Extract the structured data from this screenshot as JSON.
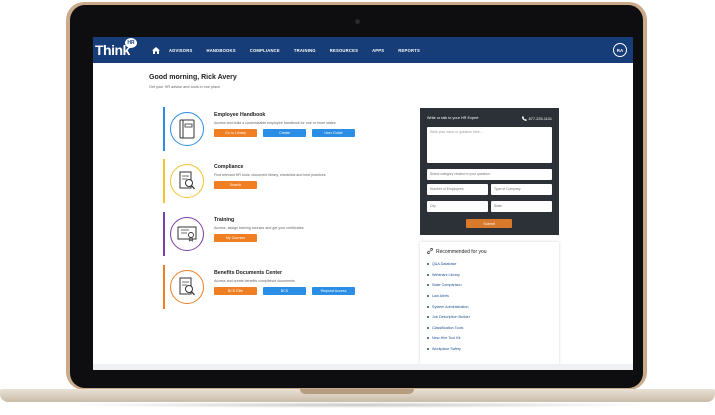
{
  "nav": {
    "logo": "Think",
    "logo_badge": "HR",
    "items": [
      "ADVISORS",
      "HANDBOOKS",
      "COMPLIANCE",
      "TRAINING",
      "RESOURCES",
      "APPS",
      "REPORTS"
    ],
    "avatar": "RA"
  },
  "greeting": {
    "title": "Good morning, Rick Avery",
    "subtitle": "Get your HR advise and tools in one place"
  },
  "cards": [
    {
      "title": "Employee Handbook",
      "desc": "Access and build a customizable employee handbook for one or more states",
      "buttons": [
        "Go to Library",
        "Create",
        "User Guide"
      ],
      "color": "#2b8ee6"
    },
    {
      "title": "Compliance",
      "desc": "Find relevant HR tools, document library, checklists and best practices",
      "buttons": [
        "Search"
      ],
      "color": "#f2c230"
    },
    {
      "title": "Training",
      "desc": "Access, assign training courses and get your certificates",
      "buttons": [
        "My Courses"
      ],
      "color": "#7b3fa8"
    },
    {
      "title": "Benefits Documents Center",
      "desc": "Access and create benefits compliance documents",
      "buttons": [
        "BCS Elite",
        "BCS",
        "Request Access"
      ],
      "color": "#f07e22"
    }
  ],
  "expert": {
    "title": "Write or talk to your HR Expert",
    "phone": "877-225-1101",
    "textarea_placeholder": "Write your issue or question here...",
    "category_placeholder": "Select category related to your question",
    "employees_placeholder": "Number of Employees",
    "company_placeholder": "Type of Company",
    "city_placeholder": "City",
    "state_placeholder": "State",
    "submit": "Submit"
  },
  "recommended": {
    "title": "Recommended for you",
    "items": [
      "Q&A Database",
      "Webinars Library",
      "State Comparison",
      "Law Alerts",
      "System Administration",
      "Job Description Builder",
      "Classification Tools",
      "New-Hire Tool Kit",
      "Workplace Safety"
    ]
  },
  "colors": {
    "nav": "#163d78",
    "orange": "#f07e22",
    "blue": "#2b8ee6",
    "panel": "#2b3136"
  }
}
